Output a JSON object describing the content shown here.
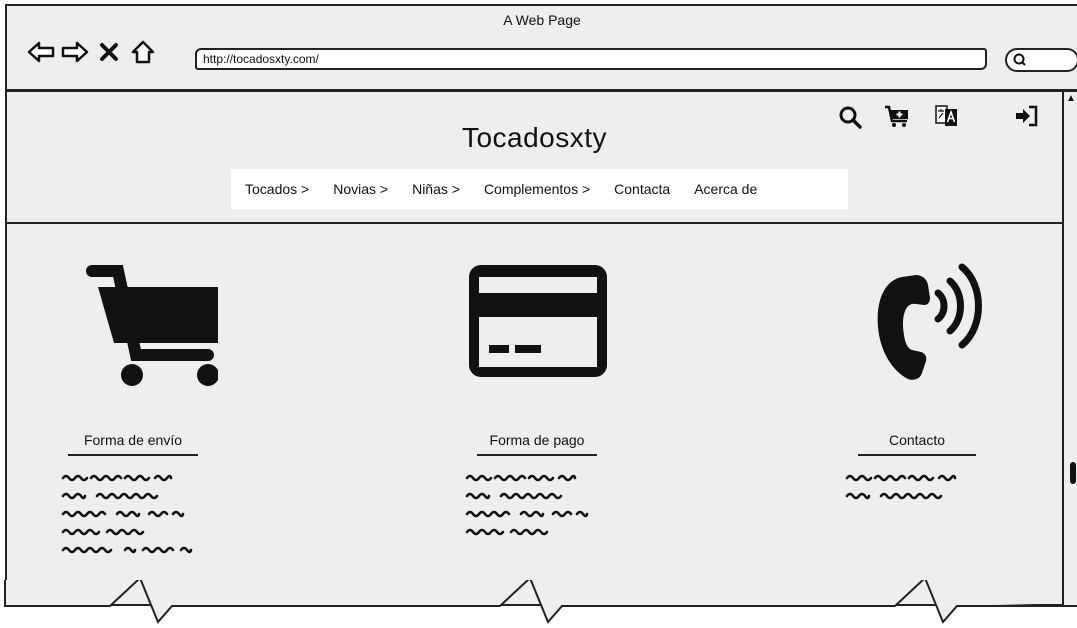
{
  "window": {
    "title": "A Web Page",
    "url": "http://tocadosxty.com/"
  },
  "site": {
    "title": "Tocadosxty",
    "menu": [
      "Tocados >",
      "Novias >",
      "Niñas >",
      "Complementos >",
      "Contacta",
      "Acerca de"
    ],
    "top_icons": [
      "search-icon",
      "add-to-cart-icon",
      "translate-icon",
      "login-icon"
    ]
  },
  "sections": [
    {
      "icon": "shopping-cart-icon",
      "label": "Forma de envío"
    },
    {
      "icon": "credit-card-icon",
      "label": "Forma de pago"
    },
    {
      "icon": "phone-ringing-icon",
      "label": "Contacto"
    }
  ]
}
